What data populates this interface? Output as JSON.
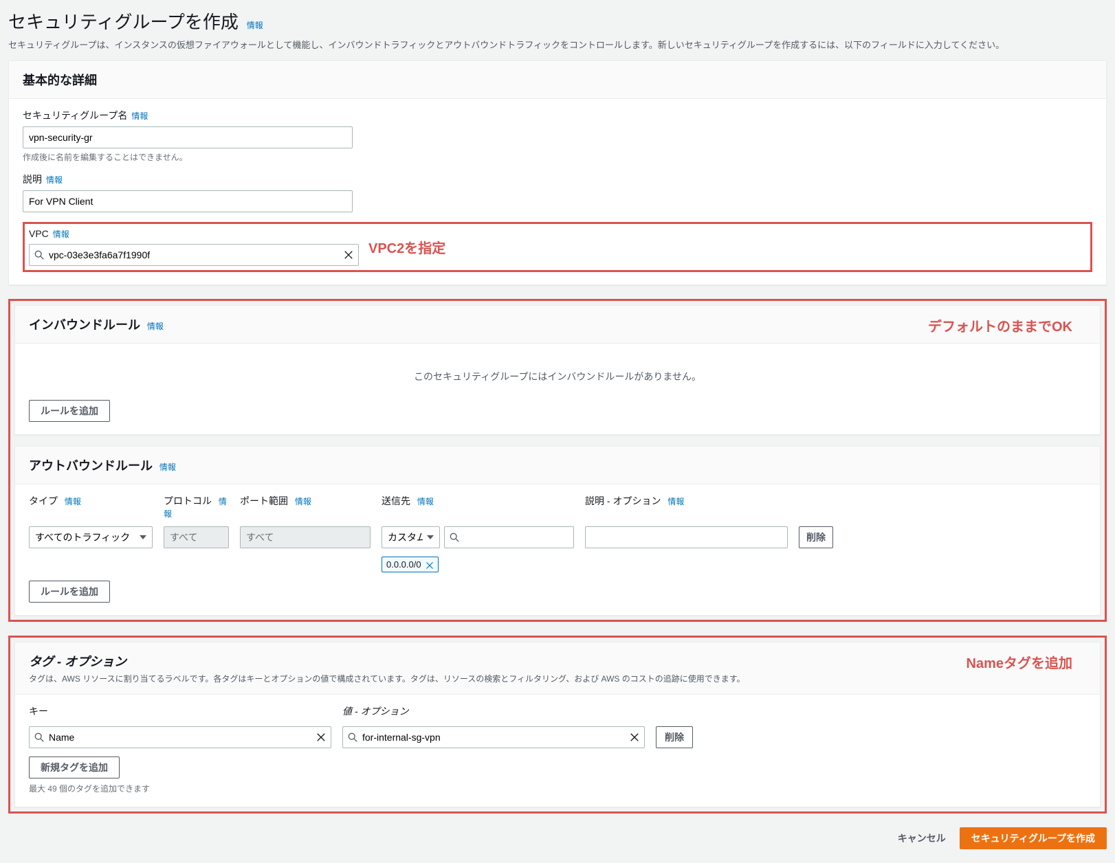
{
  "header": {
    "title": "セキュリティグループを作成",
    "info": "情報",
    "description": "セキュリティグループは、インスタンスの仮想ファイアウォールとして機能し、インバウンドトラフィックとアウトバウンドトラフィックをコントロールします。新しいセキュリティグループを作成するには、以下のフィールドに入力してください。"
  },
  "basic": {
    "panel_title": "基本的な詳細",
    "name_label": "セキュリティグループ名",
    "name_value": "vpn-security-gr",
    "name_note": "作成後に名前を編集することはできません。",
    "desc_label": "説明",
    "desc_value": "For VPN Client",
    "vpc_label": "VPC",
    "vpc_value": "vpc-03e3e3fa6a7f1990f",
    "info": "情報"
  },
  "annotations": {
    "vpc": "VPC2を指定",
    "inbound": "デフォルトのままでOK",
    "tags": "Nameタグを追加"
  },
  "inbound": {
    "panel_title": "インバウンドルール",
    "info": "情報",
    "empty": "このセキュリティグループにはインバウンドルールがありません。",
    "add_rule": "ルールを追加"
  },
  "outbound": {
    "panel_title": "アウトバウンドルール",
    "info": "情報",
    "headers": {
      "type": "タイプ",
      "protocol": "プロトコル",
      "port_range": "ポート範囲",
      "destination": "送信先",
      "description": "説明 - オプション",
      "info": "情報"
    },
    "row": {
      "type": "すべてのトラフィック",
      "protocol": "すべて",
      "port_range": "すべて",
      "dest_select": "カスタム",
      "dest_search": "",
      "cidr_token": "0.0.0.0/0",
      "description": ""
    },
    "delete": "削除",
    "add_rule": "ルールを追加"
  },
  "tags": {
    "panel_title": "タグ - オプション",
    "panel_desc": "タグは、AWS リソースに割り当てるラベルです。各タグはキーとオプションの値で構成されています。タグは、リソースの検索とフィルタリング、および AWS のコストの追跡に使用できます。",
    "key_header": "キー",
    "value_header": "値 - オプション",
    "key_value": "Name",
    "value_value": "for-internal-sg-vpn",
    "delete": "削除",
    "add_tag": "新規タグを追加",
    "limit_note": "最大 49 個のタグを追加できます"
  },
  "footer": {
    "cancel": "キャンセル",
    "create": "セキュリティグループを作成"
  }
}
